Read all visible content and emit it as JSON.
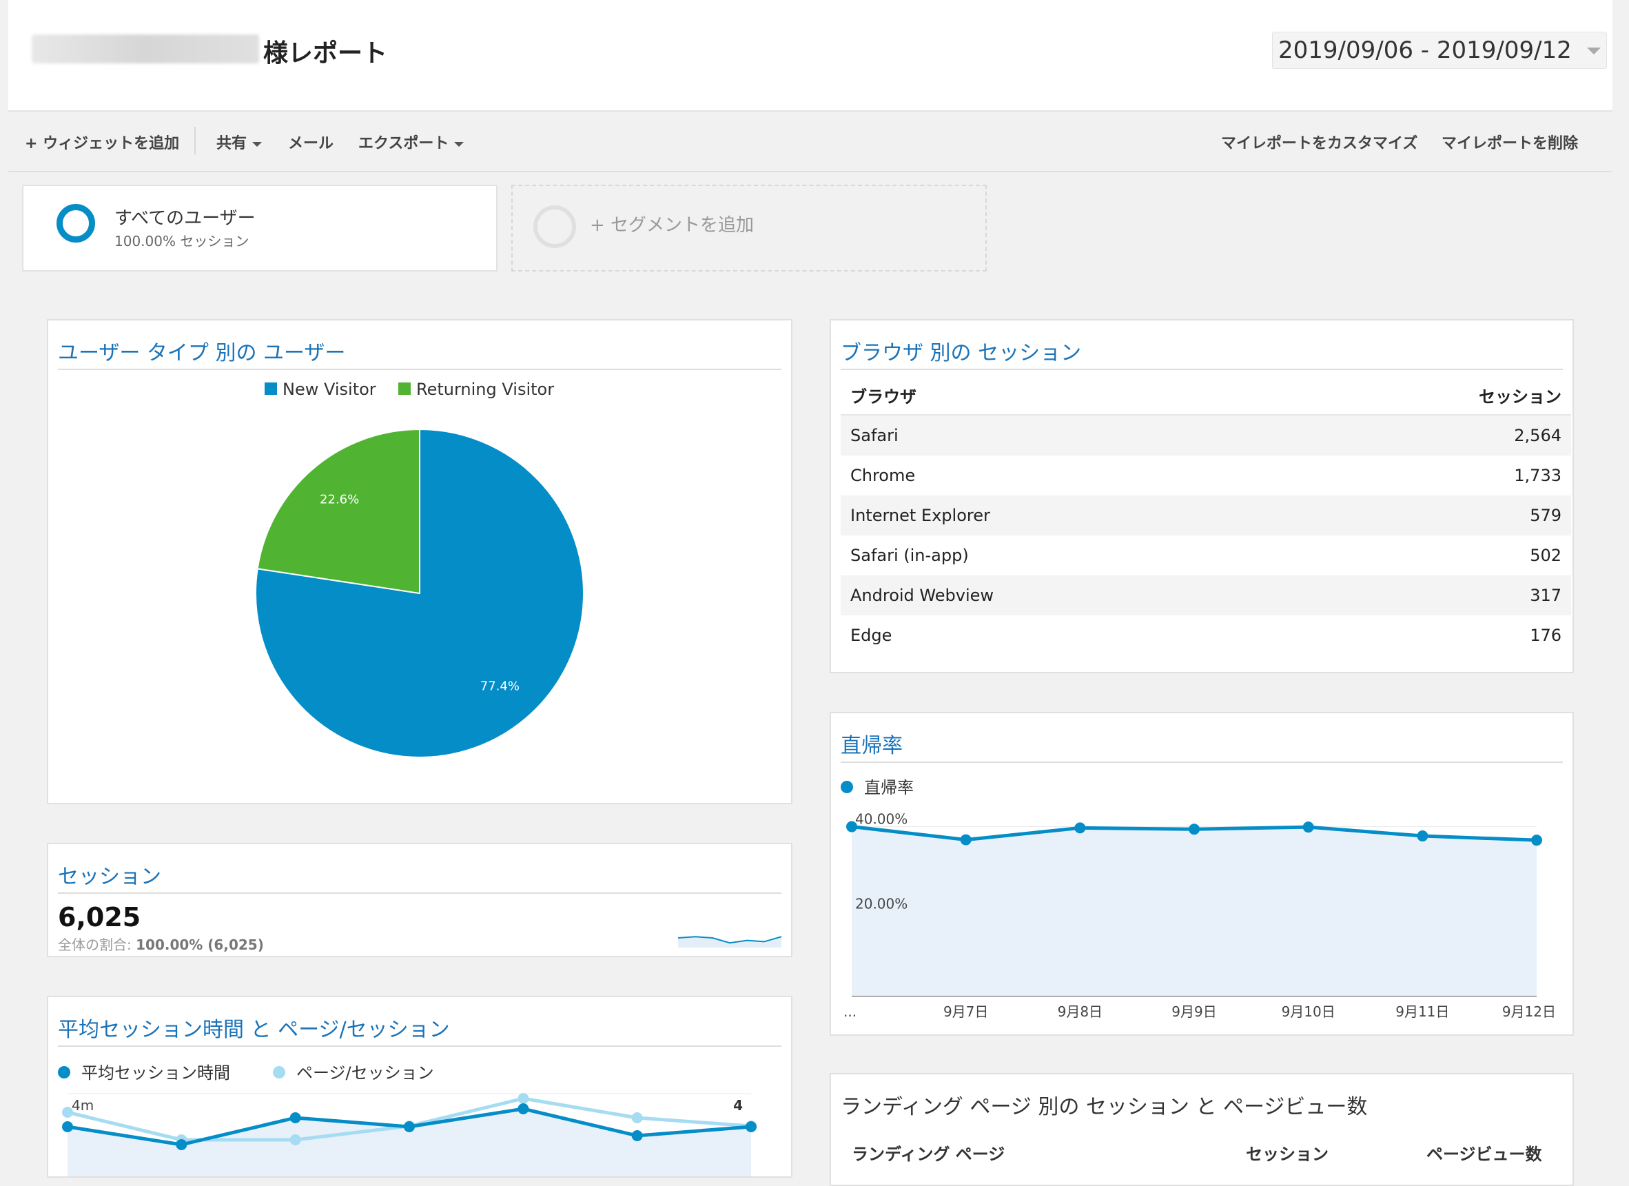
{
  "header": {
    "title": "様レポート",
    "date_range": "2019/09/06 - 2019/09/12"
  },
  "toolbar": {
    "add_widget": "+ ウィジェットを追加",
    "share": "共有",
    "mail": "メール",
    "export": "エクスポート",
    "customize": "マイレポートをカスタマイズ",
    "delete": "マイレポートを削除"
  },
  "segments": {
    "all_users": "すべてのユーザー",
    "all_users_sub": "100.00% セッション",
    "add_segment": "+ セグメントを追加"
  },
  "colors": {
    "accent_blue": "#058dc7",
    "green": "#50b432",
    "light_blue": "#a6dcf2",
    "title_blue": "#1a73b8"
  },
  "user_type_card": {
    "title": "ユーザー タイプ 別の ユーザー",
    "chart_data": {
      "type": "pie",
      "series": [
        {
          "name": "New Visitor",
          "value": 77.4,
          "label": "77.4%",
          "color": "#058dc7"
        },
        {
          "name": "Returning Visitor",
          "value": 22.6,
          "label": "22.6%",
          "color": "#50b432"
        }
      ]
    }
  },
  "browser_card": {
    "title": "ブラウザ 別の セッション",
    "columns": [
      "ブラウザ",
      "セッション"
    ],
    "rows": [
      {
        "browser": "Safari",
        "sessions": "2,564"
      },
      {
        "browser": "Chrome",
        "sessions": "1,733"
      },
      {
        "browser": "Internet Explorer",
        "sessions": "579"
      },
      {
        "browser": "Safari (in-app)",
        "sessions": "502"
      },
      {
        "browser": "Android Webview",
        "sessions": "317"
      },
      {
        "browser": "Edge",
        "sessions": "176"
      }
    ]
  },
  "sessions_card": {
    "title": "セッション",
    "value": "6,025",
    "share_label": "全体の割合: ",
    "share_value": "100.00% (6,025)",
    "sparkline": [
      0.5,
      0.55,
      0.5,
      0.3,
      0.4,
      0.35,
      0.55
    ]
  },
  "bounce_card": {
    "title": "直帰率",
    "chart_data": {
      "type": "area",
      "x": [
        "...",
        "9月7日",
        "9月8日",
        "9月9日",
        "9月10日",
        "9月11日",
        "9月12日"
      ],
      "series": [
        {
          "name": "直帰率",
          "values": [
            40.0,
            36.9,
            39.7,
            39.4,
            39.9,
            37.8,
            36.8
          ],
          "color": "#058dc7"
        }
      ],
      "ylim": [
        0,
        44
      ],
      "yticks": [
        {
          "value": 40,
          "label": "40.00%"
        },
        {
          "value": 20,
          "label": "20.00%"
        }
      ],
      "grid": true
    }
  },
  "avg_session_card": {
    "title": "平均セッション時間 と ページ/セッション",
    "chart_data": {
      "type": "line",
      "series": [
        {
          "name": "平均セッション時間",
          "axis": "left",
          "values": [
            3.3,
            3.2,
            3.35,
            3.3,
            3.4,
            3.25,
            3.3
          ],
          "color": "#058dc7"
        },
        {
          "name": "ページ/セッション",
          "axis": "right",
          "values": [
            3.95,
            3.85,
            3.85,
            3.9,
            4.0,
            3.93,
            3.9
          ],
          "color": "#a6dcf2"
        }
      ],
      "left_tick": "4m",
      "right_tick": "4",
      "grid": true
    }
  },
  "landing_card": {
    "title": "ランディング ページ 別の セッション と ページビュー数",
    "columns": [
      "ランディング ページ",
      "セッション",
      "ページビュー数"
    ]
  }
}
